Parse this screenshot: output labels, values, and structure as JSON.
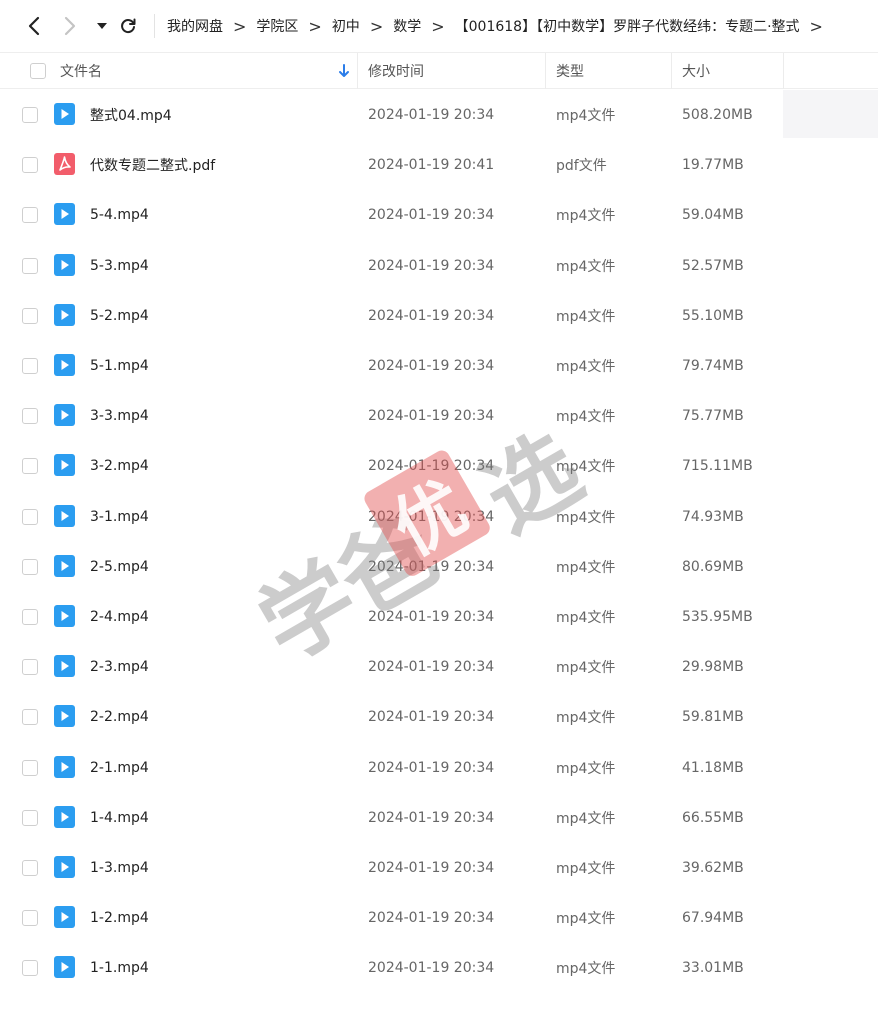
{
  "breadcrumb": [
    "我的网盘",
    "学院区",
    "初中",
    "数学",
    "【001618】【初中数学】罗胖子代数经纬：专题二·整式"
  ],
  "breadcrumb_separator": ">",
  "columns": {
    "name": "文件名",
    "modified": "修改时间",
    "type": "类型",
    "size": "大小"
  },
  "files": [
    {
      "name": "整式04.mp4",
      "modified": "2024-01-19 20:34",
      "type": "mp4文件",
      "size": "508.20MB",
      "icon": "video-file-icon"
    },
    {
      "name": "代数专题二整式.pdf",
      "modified": "2024-01-19 20:41",
      "type": "pdf文件",
      "size": "19.77MB",
      "icon": "pdf-file-icon"
    },
    {
      "name": "5-4.mp4",
      "modified": "2024-01-19 20:34",
      "type": "mp4文件",
      "size": "59.04MB",
      "icon": "video-file-icon"
    },
    {
      "name": "5-3.mp4",
      "modified": "2024-01-19 20:34",
      "type": "mp4文件",
      "size": "52.57MB",
      "icon": "video-file-icon"
    },
    {
      "name": "5-2.mp4",
      "modified": "2024-01-19 20:34",
      "type": "mp4文件",
      "size": "55.10MB",
      "icon": "video-file-icon"
    },
    {
      "name": "5-1.mp4",
      "modified": "2024-01-19 20:34",
      "type": "mp4文件",
      "size": "79.74MB",
      "icon": "video-file-icon"
    },
    {
      "name": "3-3.mp4",
      "modified": "2024-01-19 20:34",
      "type": "mp4文件",
      "size": "75.77MB",
      "icon": "video-file-icon"
    },
    {
      "name": "3-2.mp4",
      "modified": "2024-01-19 20:34",
      "type": "mp4文件",
      "size": "715.11MB",
      "icon": "video-file-icon"
    },
    {
      "name": "3-1.mp4",
      "modified": "2024-01-19 20:34",
      "type": "mp4文件",
      "size": "74.93MB",
      "icon": "video-file-icon"
    },
    {
      "name": "2-5.mp4",
      "modified": "2024-01-19 20:34",
      "type": "mp4文件",
      "size": "80.69MB",
      "icon": "video-file-icon"
    },
    {
      "name": "2-4.mp4",
      "modified": "2024-01-19 20:34",
      "type": "mp4文件",
      "size": "535.95MB",
      "icon": "video-file-icon"
    },
    {
      "name": "2-3.mp4",
      "modified": "2024-01-19 20:34",
      "type": "mp4文件",
      "size": "29.98MB",
      "icon": "video-file-icon"
    },
    {
      "name": "2-2.mp4",
      "modified": "2024-01-19 20:34",
      "type": "mp4文件",
      "size": "59.81MB",
      "icon": "video-file-icon"
    },
    {
      "name": "2-1.mp4",
      "modified": "2024-01-19 20:34",
      "type": "mp4文件",
      "size": "41.18MB",
      "icon": "video-file-icon"
    },
    {
      "name": "1-4.mp4",
      "modified": "2024-01-19 20:34",
      "type": "mp4文件",
      "size": "66.55MB",
      "icon": "video-file-icon"
    },
    {
      "name": "1-3.mp4",
      "modified": "2024-01-19 20:34",
      "type": "mp4文件",
      "size": "39.62MB",
      "icon": "video-file-icon"
    },
    {
      "name": "1-2.mp4",
      "modified": "2024-01-19 20:34",
      "type": "mp4文件",
      "size": "67.94MB",
      "icon": "video-file-icon"
    },
    {
      "name": "1-1.mp4",
      "modified": "2024-01-19 20:34",
      "type": "mp4文件",
      "size": "33.01MB",
      "icon": "video-file-icon"
    }
  ],
  "watermark": {
    "text_left": "学爸",
    "seal": "优",
    "text_right": "选"
  },
  "colors": {
    "video_icon": "#2b9df0",
    "pdf_icon": "#f25d6b",
    "sort_arrow": "#2b7de9",
    "watermark_seal": "#e25050"
  }
}
